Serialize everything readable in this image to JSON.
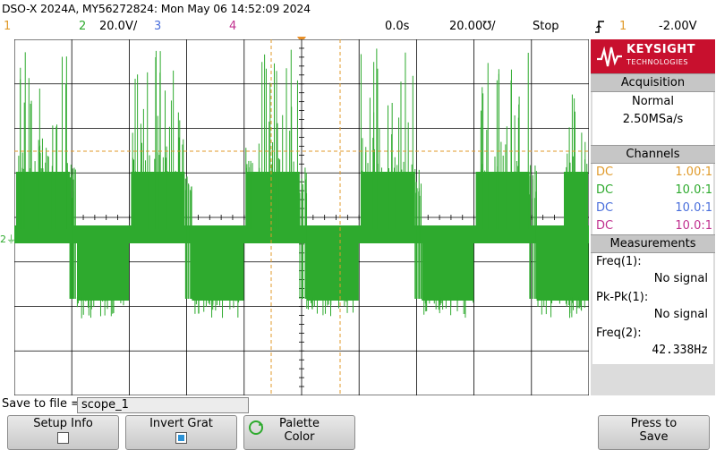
{
  "header": {
    "title": "DSO-X 2024A, MY56272824: Mon May 06 14:52:09 2024",
    "ch1_label": "1",
    "ch2_label": "2",
    "ch2_scale": "20.0V/",
    "ch3_label": "3",
    "ch4_label": "4",
    "time_delay": "0.0s",
    "time_scale": "20.00℧/",
    "run_state": "Stop",
    "trigger_icon": "trigger-edge-icon",
    "trigger_source": "1",
    "trigger_level": "-2.00V"
  },
  "panel": {
    "brand": "KEYSIGHT",
    "brand_sub": "TECHNOLOGIES",
    "acquisition": {
      "heading": "Acquisition",
      "mode": "Normal",
      "rate": "2.50MSa/s"
    },
    "channels": {
      "heading": "Channels",
      "rows": [
        {
          "coupling": "DC",
          "probe": "1.00:1",
          "color": "#e09a2a"
        },
        {
          "coupling": "DC",
          "probe": "10.0:1",
          "color": "#2eaa2e"
        },
        {
          "coupling": "DC",
          "probe": "10.0:1",
          "color": "#4a6fdc"
        },
        {
          "coupling": "DC",
          "probe": "10.0:1",
          "color": "#c0308f"
        }
      ]
    },
    "measurements": {
      "heading": "Measurements",
      "m1_label": "Freq(1):",
      "m1_value": "No signal",
      "m2_label": "Pk-Pk(1):",
      "m2_value": "No signal",
      "m3_label": "Freq(2):",
      "m3_value": "42.338Hz"
    }
  },
  "save": {
    "label": "Save to file =",
    "filename": "scope_1"
  },
  "softkeys": {
    "setup_info": "Setup Info",
    "invert_grat": "Invert Grat",
    "palette_l1": "Palette",
    "palette_l2": "Color",
    "press_l1": "Press to",
    "press_l2": "Save"
  },
  "colors": {
    "ch1": "#e09a2a",
    "ch2": "#2eaa2e",
    "ch3": "#4a6fdc",
    "ch4": "#c0308f",
    "brand": "#c8102e"
  }
}
